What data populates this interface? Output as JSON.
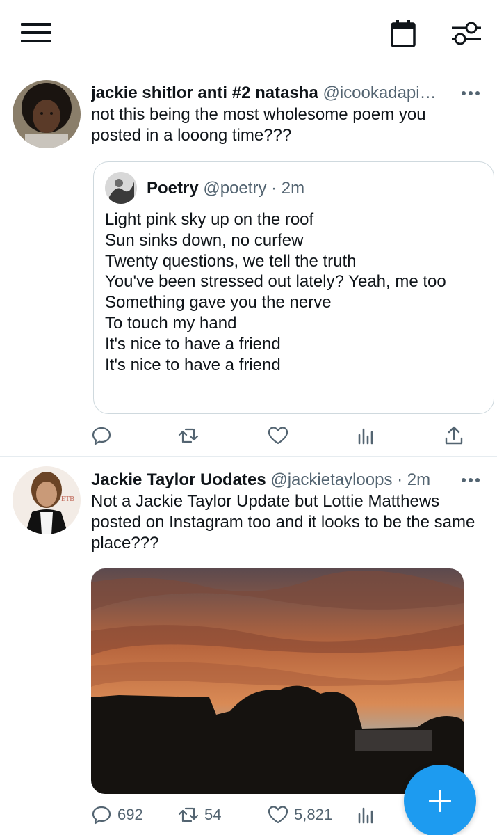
{
  "topbar": {
    "menu_icon": "hamburger-menu-icon",
    "calendar_icon": "calendar-icon",
    "filter_icon": "timeline-settings-icon"
  },
  "tweets": [
    {
      "display_name": "jackie shitlor anti #2 natasha",
      "handle": "@icookadapi…",
      "text": "not this being the most wholesome poem you posted in a looong time???",
      "quote": {
        "display_name": "Poetry",
        "handle": "@poetry",
        "time": "· 2m",
        "lines": [
          "Light pink sky up on the roof",
          "Sun sinks down, no curfew",
          "Twenty questions, we tell the truth",
          "You've been stressed out lately? Yeah, me too",
          "Something gave you the nerve",
          "To touch my hand",
          "It's nice to have a friend",
          "It's nice to have a friend"
        ]
      },
      "actions": {
        "reply": "",
        "retweet": "",
        "like": ""
      }
    },
    {
      "display_name": "Jackie Taylor Uodates",
      "handle": "@jackietayloops",
      "time": "· 2m",
      "text": "Not a Jackie Taylor Update but Lottie Matthews posted on Instagram too and it looks to be the same place???",
      "media": "sunset-photo",
      "actions": {
        "reply": "692",
        "retweet": "54",
        "like": "5,821"
      }
    }
  ],
  "fab": {
    "icon": "plus-icon"
  },
  "colors": {
    "accent": "#1d9bf0",
    "secondary_text": "#536471",
    "border": "#cfd9de"
  }
}
